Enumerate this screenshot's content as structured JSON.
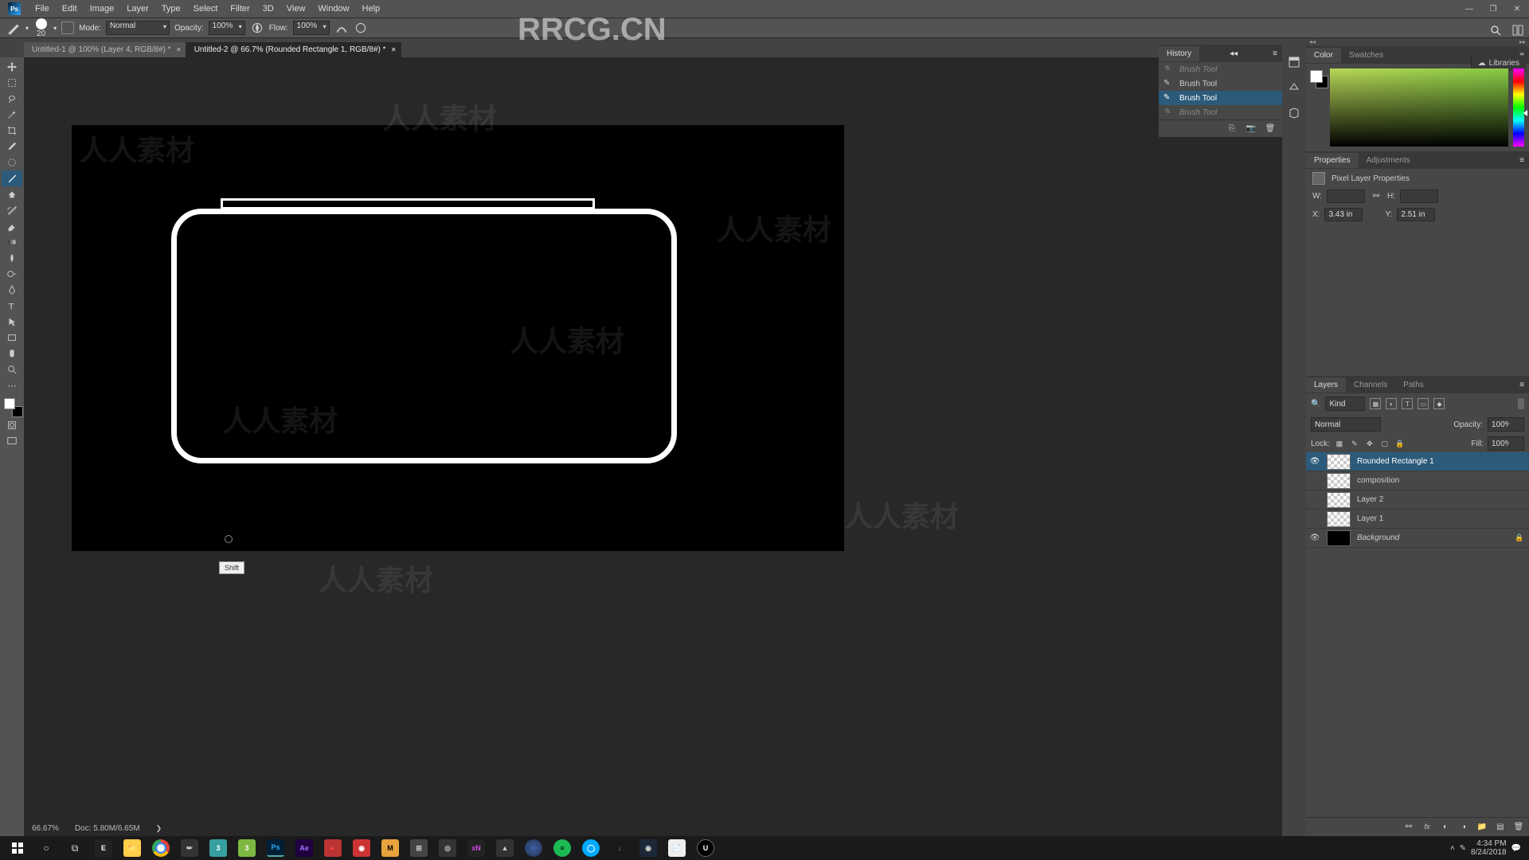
{
  "menu": {
    "items": [
      "File",
      "Edit",
      "Image",
      "Layer",
      "Type",
      "Select",
      "Filter",
      "3D",
      "View",
      "Window",
      "Help"
    ]
  },
  "options": {
    "brush_size": "20",
    "mode_label": "Mode:",
    "mode_value": "Normal",
    "opacity_label": "Opacity:",
    "opacity_value": "100%",
    "flow_label": "Flow:",
    "flow_value": "100%"
  },
  "tabs": [
    {
      "label": "Untitled-1 @ 100% (Layer 4, RGB/8#) *"
    },
    {
      "label": "Untitled-2 @ 66.7% (Rounded Rectangle 1, RGB/8#) *"
    }
  ],
  "status": {
    "zoom": "66.67%",
    "doc": "Doc: 5.80M/6.65M"
  },
  "key_hint": "Shift",
  "history": {
    "title": "History",
    "items": [
      {
        "label": "Brush Tool",
        "state": "dim"
      },
      {
        "label": "Brush Tool",
        "state": ""
      },
      {
        "label": "Brush Tool",
        "state": "sel"
      },
      {
        "label": "Brush Tool",
        "state": "dim"
      }
    ]
  },
  "color_panel": {
    "tabs": [
      "Color",
      "Swatches"
    ]
  },
  "libraries": {
    "label": "Libraries"
  },
  "properties": {
    "tabs": [
      "Properties",
      "Adjustments"
    ],
    "title": "Pixel Layer Properties",
    "w_label": "W:",
    "w_val": "",
    "h_label": "H:",
    "h_val": "",
    "x_label": "X:",
    "x_val": "3.43 in",
    "y_label": "Y:",
    "y_val": "2.51 in"
  },
  "layers": {
    "tabs": [
      "Layers",
      "Channels",
      "Paths"
    ],
    "kind_label": "Kind",
    "blend_value": "Normal",
    "opacity_label": "Opacity:",
    "opacity_value": "100%",
    "lock_label": "Lock:",
    "fill_label": "Fill:",
    "fill_value": "100%",
    "items": [
      {
        "name": "Rounded Rectangle 1",
        "visible": true,
        "selected": true,
        "thumb": "checker"
      },
      {
        "name": "composition",
        "visible": false,
        "thumb": "checker"
      },
      {
        "name": "Layer 2",
        "visible": false,
        "thumb": "checker"
      },
      {
        "name": "Layer 1",
        "visible": false,
        "thumb": "checker"
      },
      {
        "name": "Background",
        "visible": true,
        "locked": true,
        "italic": true,
        "thumb": "black"
      }
    ]
  },
  "taskbar": {
    "time": "4:34 PM",
    "date": "8/24/2018"
  },
  "watermark": {
    "brand": "RRCG.CN",
    "sub": "人人素材"
  }
}
